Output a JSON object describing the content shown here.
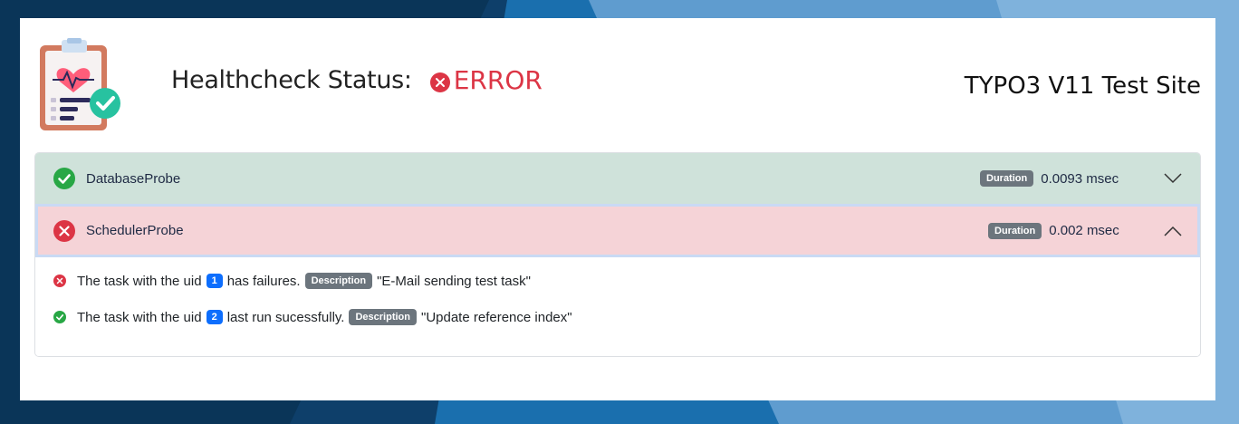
{
  "header": {
    "status_label": "Healthcheck Status:",
    "status_value": "ERROR",
    "site_name": "TYPO3 V11 Test Site"
  },
  "probes": [
    {
      "name": "DatabaseProbe",
      "state": "ok",
      "duration_label": "Duration",
      "duration_value": "0.0093 msec",
      "expanded": false
    },
    {
      "name": "SchedulerProbe",
      "state": "error",
      "duration_label": "Duration",
      "duration_value": "0.002 msec",
      "expanded": true
    }
  ],
  "scheduler_details": [
    {
      "state": "error",
      "prefix": "The task with the uid",
      "uid": "1",
      "suffix": "has failures.",
      "desc_label": "Description",
      "desc_value": "\"E-Mail sending test task\""
    },
    {
      "state": "ok",
      "prefix": "The task with the uid",
      "uid": "2",
      "suffix": "last run sucessfully.",
      "desc_label": "Description",
      "desc_value": "\"Update reference index\""
    }
  ],
  "colors": {
    "error": "#dc3545",
    "success": "#28a745",
    "ok_row_bg": "#cfe2da",
    "error_row_bg": "#f5d3d7",
    "uid_badge": "#0d6efd",
    "desc_badge": "#6c757d"
  },
  "icons": {
    "logo": "clipboard-heart-check-icon",
    "ok": "check-circle-icon",
    "error": "x-circle-icon",
    "collapsed": "chevron-down-icon",
    "expanded": "chevron-up-icon"
  }
}
